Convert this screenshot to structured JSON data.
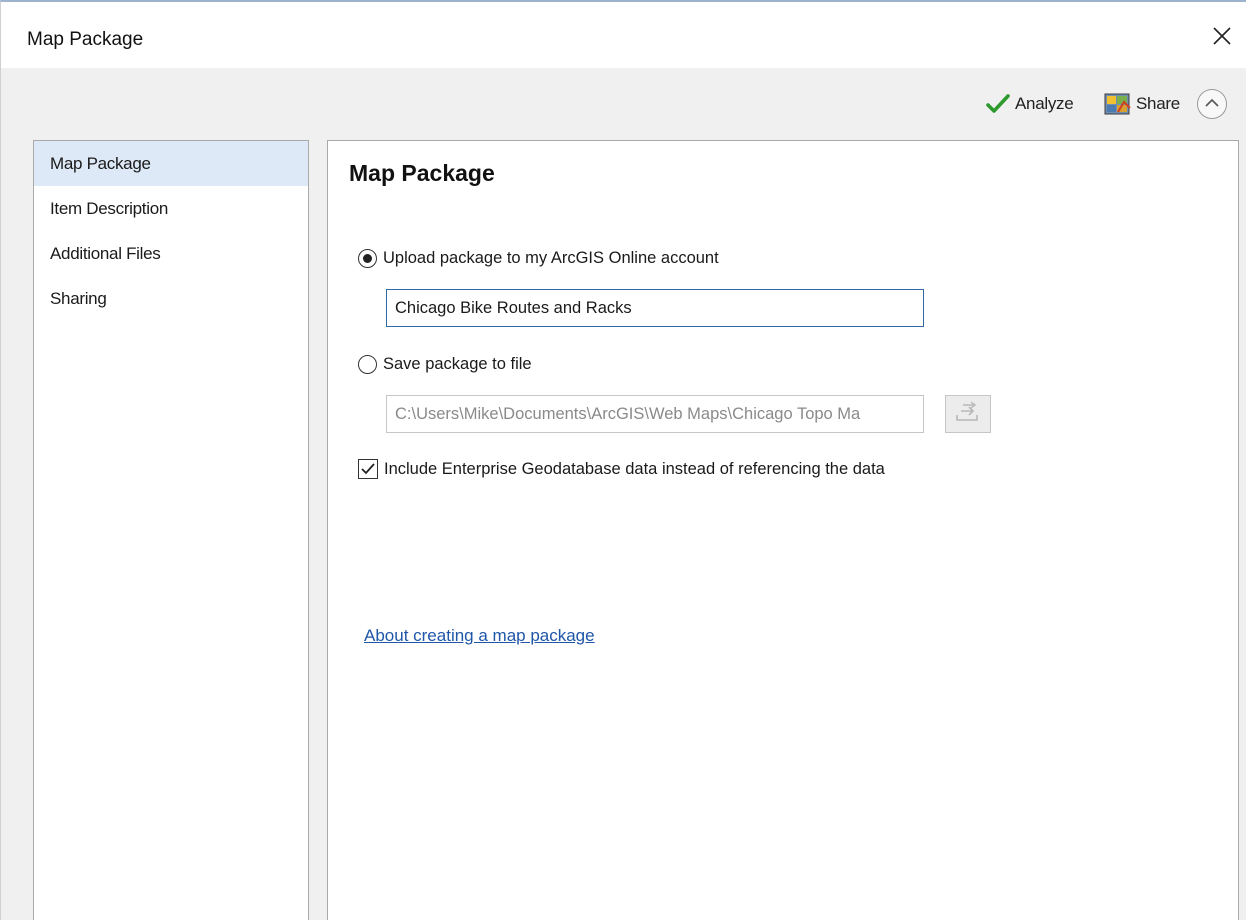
{
  "window": {
    "title": "Map Package"
  },
  "toolbar": {
    "analyze_label": "Analyze",
    "share_label": "Share"
  },
  "sidebar": {
    "items": [
      {
        "label": "Map Package",
        "selected": true
      },
      {
        "label": "Item Description",
        "selected": false
      },
      {
        "label": "Additional Files",
        "selected": false
      },
      {
        "label": "Sharing",
        "selected": false
      }
    ]
  },
  "main": {
    "title": "Map Package",
    "upload_option": {
      "label": "Upload package to my ArcGIS Online account",
      "selected": true,
      "value": "Chicago Bike Routes and Racks"
    },
    "save_option": {
      "label": "Save package to file",
      "selected": false,
      "path_value": "C:\\Users\\Mike\\Documents\\ArcGIS\\Web Maps\\Chicago Topo Ma"
    },
    "include_enterprise": {
      "label": "Include Enterprise Geodatabase data instead of referencing the data",
      "checked": true
    },
    "help_link": "About creating a map package"
  },
  "colors": {
    "selected_nav": "#dde9f6",
    "link": "#1f56a8",
    "field_focus_border": "#2f6aa6",
    "analyze_check": "#2e9a2e"
  },
  "icons": {
    "close": "close-icon",
    "analyze": "checkmark-icon",
    "share": "share-icon",
    "collapse": "chevron-up-icon",
    "browse": "browse-folder-icon"
  }
}
